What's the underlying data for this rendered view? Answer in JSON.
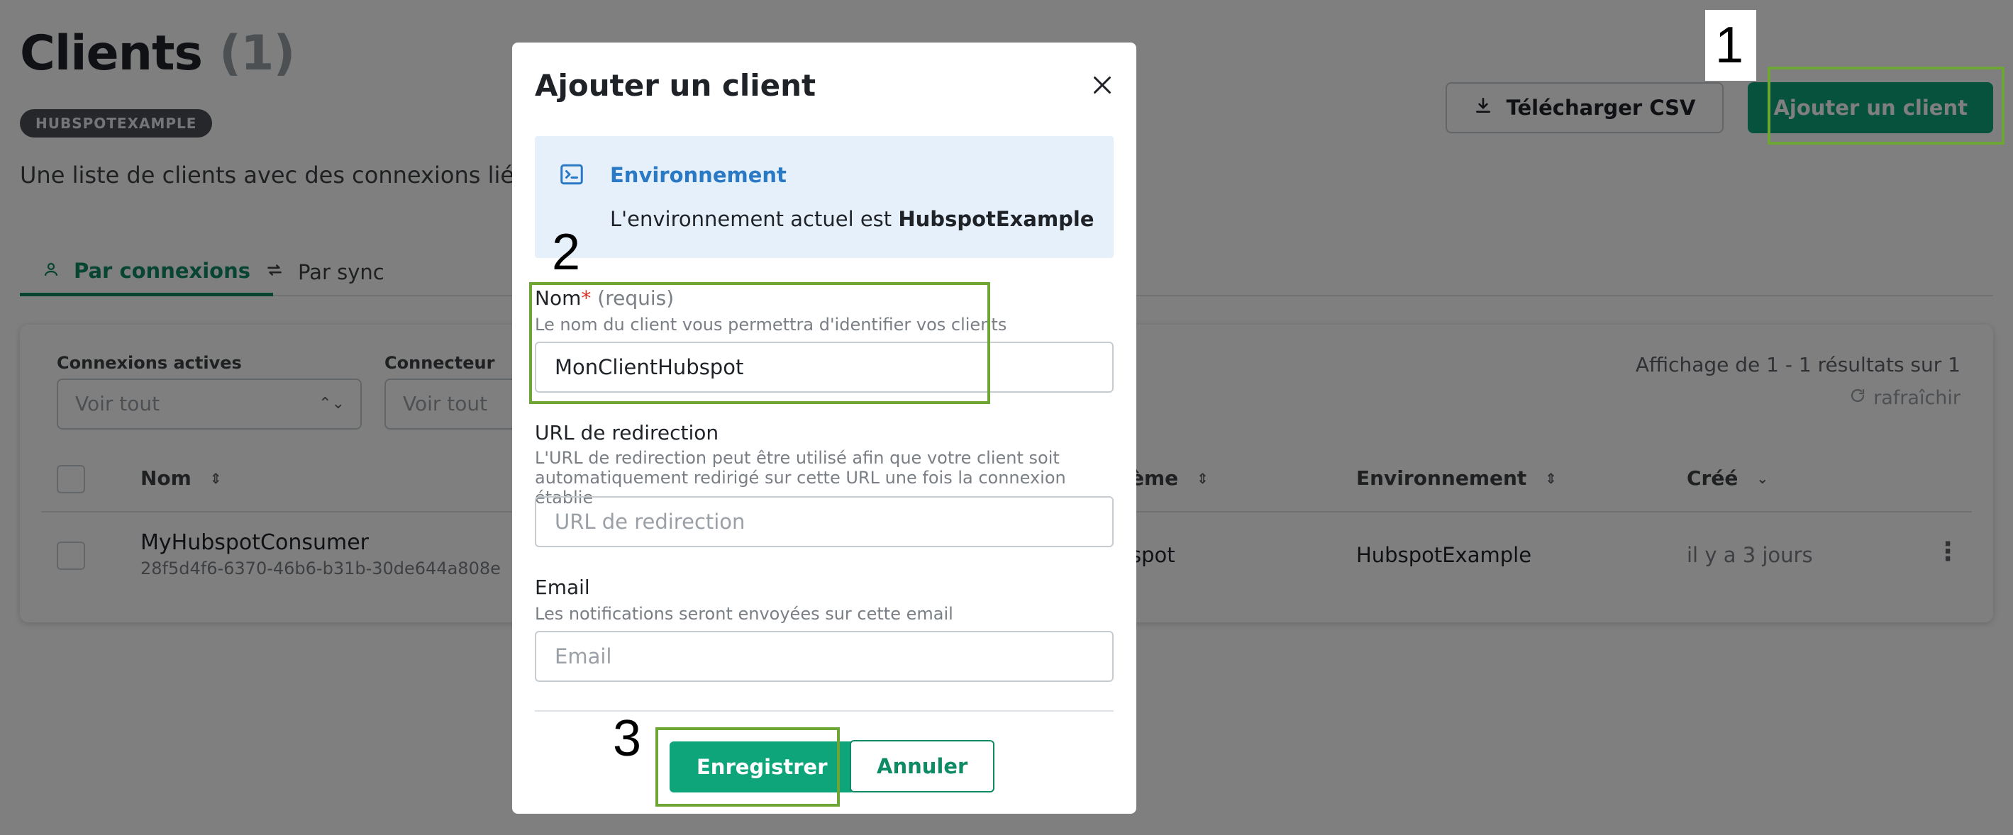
{
  "page": {
    "title": "Clients",
    "title_count": "(1)",
    "env_badge": "HUBSPOTEXAMPLE",
    "description": "Une liste de clients avec des connexions liées à"
  },
  "header": {
    "download_csv_label": "Télécharger CSV",
    "add_client_label": "Ajouter un client"
  },
  "tabs": [
    {
      "label": "Par connexions",
      "icon": "user-icon",
      "active": true
    },
    {
      "label": "Par sync",
      "icon": "sync-icon",
      "active": false
    }
  ],
  "filters": {
    "active_connections": {
      "label": "Connexions actives",
      "value": "Voir tout"
    },
    "connector": {
      "label": "Connecteur",
      "value": "Voir tout"
    },
    "results_text": "Affichage de 1 - 1 résultats sur 1",
    "refresh_label": "rafraîchir"
  },
  "table": {
    "columns": [
      {
        "label": "Nom"
      },
      {
        "label": "ème"
      },
      {
        "label": "Environnement"
      },
      {
        "label": "Créé"
      }
    ],
    "rows": [
      {
        "name": "MyHubspotConsumer",
        "id": "28f5d4f6-6370-46b6-b31b-30de644a808e",
        "system": "spot",
        "environment": "HubspotExample",
        "created": "il y a 3 jours"
      }
    ]
  },
  "modal": {
    "title": "Ajouter un client",
    "env_box": {
      "title": "Environnement",
      "text_prefix": "L'environnement actuel est ",
      "env_name": "HubspotExample"
    },
    "name_field": {
      "label": "Nom",
      "required_mark": "*",
      "required_text": "(requis)",
      "help": "Le nom du client vous permettra d'identifier vos clients",
      "value": "MonClientHubspot"
    },
    "redirect_field": {
      "label": "URL de redirection",
      "help": "L'URL de redirection peut être utilisé afin que votre client soit automatiquement redirigé sur cette URL une fois la connexion établie",
      "placeholder": "URL de redirection"
    },
    "email_field": {
      "label": "Email",
      "help": "Les notifications seront envoyées sur cette email",
      "placeholder": "Email"
    },
    "save_label": "Enregistrer",
    "cancel_label": "Annuler"
  },
  "annotations": {
    "marker_1": "1",
    "marker_2": "2",
    "marker_3": "3"
  },
  "colors": {
    "primary": "#0ea57a",
    "primary_dark": "#0e8a64",
    "highlight": "#6ea636",
    "info_bg": "#e6f0fb",
    "info_text": "#2a79c4",
    "required": "#d93025"
  }
}
